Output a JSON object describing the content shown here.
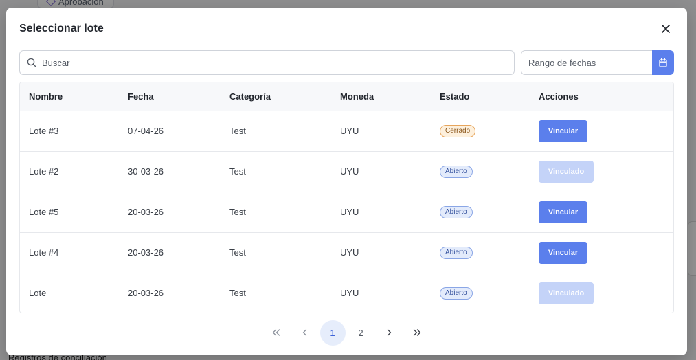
{
  "background": {
    "top_item_label": "Aprobación",
    "bottom_item_label": "Registros de conciliación"
  },
  "modal": {
    "title": "Seleccionar lote",
    "search": {
      "placeholder": "Buscar",
      "value": ""
    },
    "date_range": {
      "placeholder": "Rango de fechas",
      "value": ""
    },
    "columns": [
      "Nombre",
      "Fecha",
      "Categoría",
      "Moneda",
      "Estado",
      "Acciones"
    ],
    "rows": [
      {
        "nombre": "Lote #3",
        "fecha": "07-04-26",
        "categoria": "Test",
        "moneda": "UYU",
        "estado": "Cerrado",
        "estado_key": "cerrado",
        "accion": "Vincular",
        "accion_enabled": true
      },
      {
        "nombre": "Lote #2",
        "fecha": "30-03-26",
        "categoria": "Test",
        "moneda": "UYU",
        "estado": "Abierto",
        "estado_key": "abierto",
        "accion": "Vinculado",
        "accion_enabled": false
      },
      {
        "nombre": "Lote #5",
        "fecha": "20-03-26",
        "categoria": "Test",
        "moneda": "UYU",
        "estado": "Abierto",
        "estado_key": "abierto",
        "accion": "Vincular",
        "accion_enabled": true
      },
      {
        "nombre": "Lote #4",
        "fecha": "20-03-26",
        "categoria": "Test",
        "moneda": "UYU",
        "estado": "Abierto",
        "estado_key": "abierto",
        "accion": "Vincular",
        "accion_enabled": true
      },
      {
        "nombre": "Lote",
        "fecha": "20-03-26",
        "categoria": "Test",
        "moneda": "UYU",
        "estado": "Abierto",
        "estado_key": "abierto",
        "accion": "Vinculado",
        "accion_enabled": false
      }
    ],
    "pagination": {
      "first": "«",
      "prev": "‹",
      "pages": [
        "1",
        "2"
      ],
      "current": "1",
      "next": "›",
      "last": "»"
    }
  },
  "icons": {
    "close": "close-icon",
    "search": "search-icon",
    "calendar": "calendar-icon"
  },
  "colors": {
    "primary": "#5b7fec",
    "primary_disabled": "#c4d3f8",
    "closed_badge_border": "#e7a55c",
    "open_badge_border": "#8aa6e6"
  }
}
